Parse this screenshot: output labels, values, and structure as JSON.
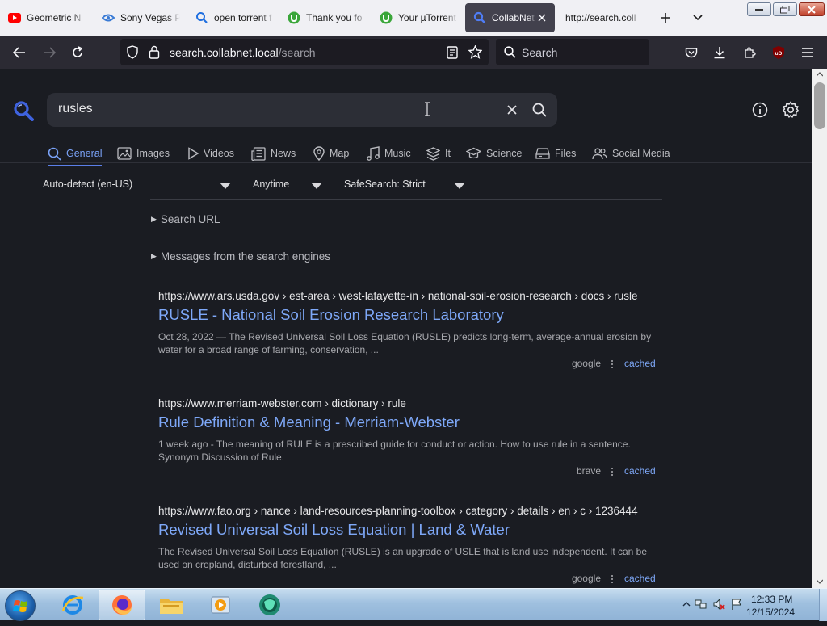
{
  "browser": {
    "tabs": [
      {
        "title": "Geometric N",
        "icon": "youtube-icon",
        "color": "#ff0000"
      },
      {
        "title": "Sony Vegas P",
        "icon": "sony-vegas-icon",
        "color": "#3a7bd5"
      },
      {
        "title": "open torrent f",
        "icon": "search-icon",
        "color": "#1f6fe0"
      },
      {
        "title": "Thank you fo",
        "icon": "utorrent-icon",
        "color": "#3aa63a"
      },
      {
        "title": "Your µTorrent",
        "icon": "utorrent-icon",
        "color": "#3aa63a"
      },
      {
        "title": "CollabNet",
        "icon": "search-icon",
        "color": "#4f7df5",
        "active": true
      },
      {
        "title": "http://search.coll",
        "icon": "none"
      }
    ],
    "url": {
      "host": "search.collabnet.local",
      "path": "/search"
    },
    "search_placeholder": "Search",
    "ublock_label": "uD"
  },
  "search": {
    "query": "rusles",
    "categories": [
      {
        "label": "General",
        "icon": "magnifier-icon",
        "active": true
      },
      {
        "label": "Images",
        "icon": "image-icon"
      },
      {
        "label": "Videos",
        "icon": "play-icon"
      },
      {
        "label": "News",
        "icon": "newspaper-icon"
      },
      {
        "label": "Map",
        "icon": "map-pin-icon"
      },
      {
        "label": "Music",
        "icon": "music-note-icon"
      },
      {
        "label": "It",
        "icon": "layers-icon"
      },
      {
        "label": "Science",
        "icon": "graduation-cap-icon"
      },
      {
        "label": "Files",
        "icon": "drive-icon"
      },
      {
        "label": "Social Media",
        "icon": "users-icon"
      }
    ],
    "filters": {
      "language": "Auto-detect (en-US)",
      "time": "Anytime",
      "safesearch": "SafeSearch: Strict"
    },
    "details": {
      "search_url": "Search URL",
      "engine_messages": "Messages from the search engines"
    },
    "results": [
      {
        "url": "https://www.ars.usda.gov",
        "path": "› est-area › west-lafayette-in › national-soil-erosion-research › docs › rusle",
        "title": "RUSLE - National Soil Erosion Research Laboratory",
        "snippet": "Oct 28, 2022 — The Revised Universal Soil Loss Equation (RUSLE) predicts long-term, average-annual erosion by water for a broad range of farming, conservation, ...",
        "engine": "google",
        "cached": "cached"
      },
      {
        "url": "https://www.merriam-webster.com",
        "path": "› dictionary › rule",
        "title": "Rule Definition & Meaning - Merriam-Webster",
        "snippet": "1 week ago - The meaning of RULE is a prescribed guide for conduct or action. How to use rule in a sentence. Synonym Discussion of Rule.",
        "engine": "brave",
        "cached": "cached"
      },
      {
        "url": "https://www.fao.org",
        "path": "› nance › land-resources-planning-toolbox › category › details › en › c › 1236444",
        "title": "Revised Universal Soil Loss Equation | Land & Water",
        "snippet": "The Revised Universal Soil Loss Equation (RUSLE) is an upgrade of USLE that is land use independent. It can be used on cropland, disturbed forestland, ...",
        "engine": "google",
        "cached": "cached"
      }
    ]
  },
  "taskbar": {
    "apps": [
      "internet-explorer",
      "firefox",
      "file-explorer",
      "media-player",
      "browser-app"
    ],
    "clock_time": "12:33 PM",
    "clock_date": "12/15/2024"
  },
  "colors": {
    "accent": "#7ea8f8",
    "page_bg": "#1a1c22",
    "active_tab": "#42414d"
  }
}
